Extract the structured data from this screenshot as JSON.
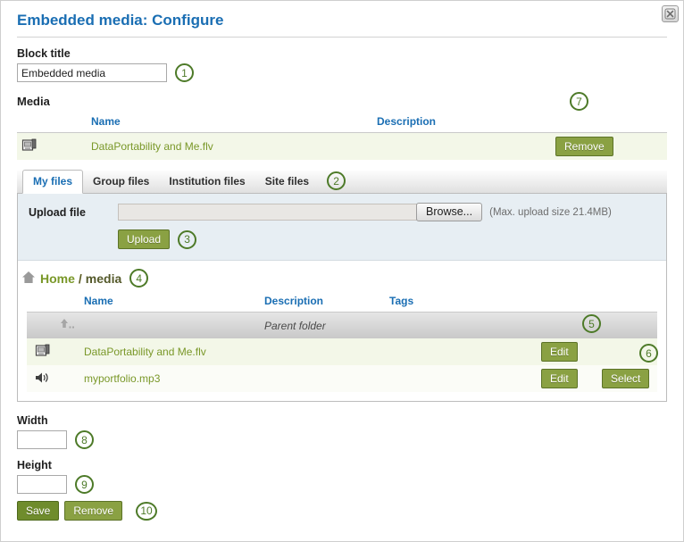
{
  "dialog": {
    "title": "Embedded media: Configure",
    "close_icon": "close-icon"
  },
  "block_title": {
    "label": "Block title",
    "value": "Embedded media",
    "step": "1"
  },
  "media": {
    "label": "Media",
    "columns": [
      "Name",
      "Description"
    ],
    "rows": [
      {
        "icon": "video-file-icon",
        "name": "DataPortability and Me.flv",
        "description": "",
        "action": "Remove"
      }
    ],
    "remove_step": "7"
  },
  "tabs": {
    "items": [
      {
        "label": "My files",
        "active": true
      },
      {
        "label": "Group files",
        "active": false
      },
      {
        "label": "Institution files",
        "active": false
      },
      {
        "label": "Site files",
        "active": false
      }
    ],
    "step": "2"
  },
  "upload": {
    "label": "Upload file",
    "value": "",
    "browse_label": "Browse...",
    "max_size_note": "(Max. upload size 21.4MB)",
    "upload_label": "Upload",
    "step": "3"
  },
  "breadcrumb": {
    "home_icon": "home-icon",
    "home": "Home",
    "separator": "/",
    "current": "media",
    "step": "4"
  },
  "filebrowser": {
    "columns": [
      "Name",
      "Description",
      "Tags"
    ],
    "parent_row": {
      "icon": "up-folder-icon",
      "label": "Parent folder"
    },
    "rows": [
      {
        "icon": "video-file-icon",
        "name": "DataPortability and Me.flv",
        "description": "",
        "tags": "",
        "edit_label": "Edit",
        "select_label": ""
      },
      {
        "icon": "audio-file-icon",
        "name": "myportfolio.mp3",
        "description": "",
        "tags": "",
        "edit_label": "Edit",
        "select_label": "Select"
      }
    ],
    "edit_step": "5",
    "select_step": "6"
  },
  "width": {
    "label": "Width",
    "value": "",
    "step": "8"
  },
  "height": {
    "label": "Height",
    "value": "",
    "step": "9"
  },
  "footer": {
    "save_label": "Save",
    "remove_label": "Remove",
    "step": "10"
  },
  "colors": {
    "title_blue": "#1a6eb3",
    "link_green": "#7a9829",
    "button_green": "#8aa143",
    "button_green_dark": "#6f8c2c",
    "step_marker": "#4d7a28",
    "panel_blue_grey": "#e7eef3"
  }
}
